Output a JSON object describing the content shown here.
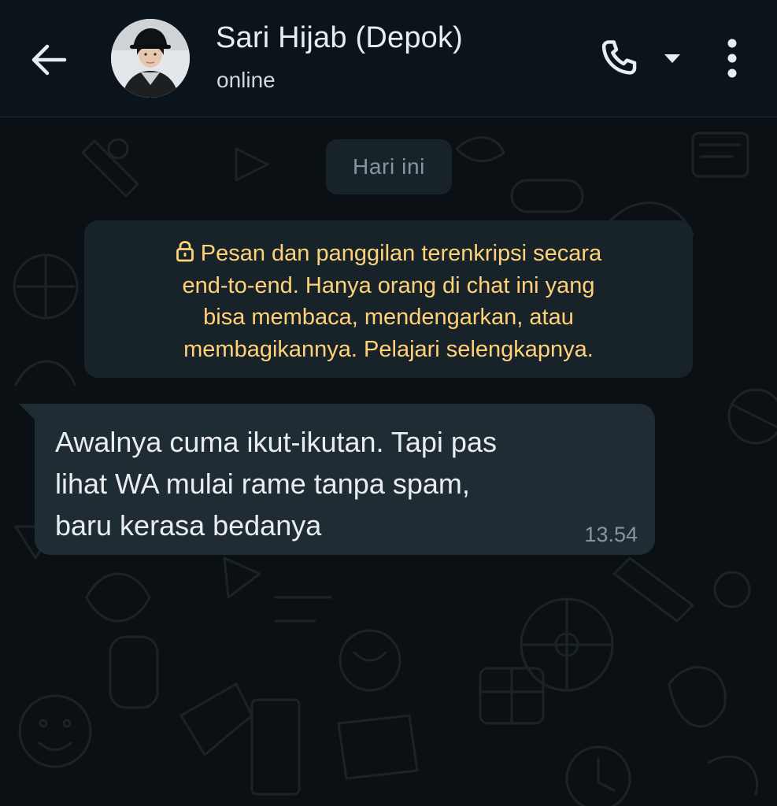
{
  "header": {
    "contact_name": "Sari Hijab (Depok)",
    "status": "online",
    "icons": {
      "back": "arrow-left",
      "avatar": "profile-photo",
      "call": "phone",
      "dropdown": "caret-down",
      "menu": "more-vertical"
    }
  },
  "chat": {
    "date_chip": "Hari ini",
    "encryption_notice": {
      "line1": "Pesan dan panggilan terenkripsi secara",
      "line2": "end-to-end. Hanya orang di chat ini yang",
      "line3": "bisa membaca, mendengarkan, atau",
      "line4": "membagikannya. Pelajari selengkapnya.",
      "icon": "lock"
    },
    "messages": [
      {
        "direction": "incoming",
        "line1": "Awalnya cuma ikut-ikutan. Tapi pas",
        "line2": "lihat WA mulai rame tanpa spam,",
        "line3": "baru kerasa bedanya",
        "time": "13.54"
      }
    ]
  },
  "colors": {
    "header_bg": "#0b141a",
    "chat_bg": "#0b1014",
    "bubble_in": "#202c33",
    "system_bubble": "#182229",
    "encryption_text": "#ffd279",
    "primary_text": "#e9edef",
    "secondary_text": "#8696a0"
  }
}
